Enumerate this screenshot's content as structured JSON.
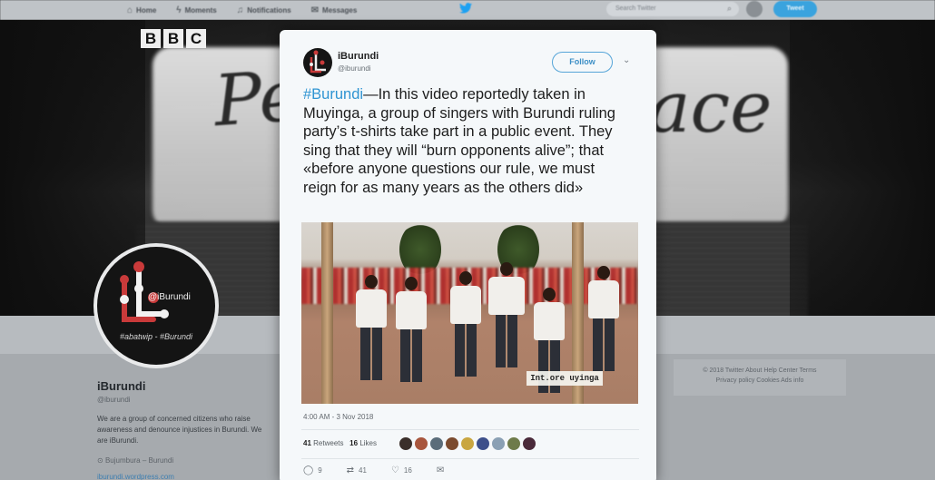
{
  "nav": {
    "items": [
      {
        "icon": "home-icon",
        "glyph": "⌂",
        "label": "Home"
      },
      {
        "icon": "moments-icon",
        "glyph": "ϟ",
        "label": "Moments"
      },
      {
        "icon": "bell-icon",
        "glyph": "♫",
        "label": "Notifications"
      },
      {
        "icon": "mail-icon",
        "glyph": "✉",
        "label": "Messages"
      }
    ],
    "search_placeholder": "Search Twitter",
    "tweet_button": "Tweet"
  },
  "overlay": {
    "broadcaster_letters": [
      "B",
      "B",
      "C"
    ]
  },
  "header": {
    "script_left": "Pe",
    "script_right": "ace"
  },
  "profile": {
    "avatar_handle": "@iBurundi",
    "avatar_tags": "#abatwip - #Burundi",
    "name": "iBurundi",
    "handle": "@iburundi",
    "bio": "We are a group of concerned citizens who raise awareness and denounce injustices in Burundi. We are iBurundi.",
    "location": "Bujumbura – Burundi",
    "link": "iburundi.wordpress.com"
  },
  "footer": {
    "line1": "© 2018 Twitter   About   Help Center   Terms",
    "line2": "Privacy policy   Cookies   Ads info"
  },
  "tweet": {
    "name": "iBurundi",
    "handle": "@iburundi",
    "follow_label": "Follow",
    "hashtag": "#Burundi",
    "body": "—In this video reportedly taken in Muyinga, a group of singers with Burundi ruling party’s t-shirts take part in a public event. They sing that  they will “burn opponents alive”; that «before anyone questions our rule, we must reign for as many years as the others did»",
    "video_caption": "Int.ore uyinga",
    "timestamp": "4:00 AM - 3 Nov 2018",
    "retweets_count": "41",
    "retweets_label": "Retweets",
    "likes_count": "16",
    "likes_label": "Likes",
    "liker_colors": [
      "#3a2f2a",
      "#a8563d",
      "#5b6d7a",
      "#7b4b2f",
      "#c9a640",
      "#3c4f8a",
      "#8aa0b4",
      "#6e7b4a",
      "#4a2a3a"
    ],
    "actions": [
      {
        "icon": "reply-icon",
        "glyph": "◯",
        "count": "9"
      },
      {
        "icon": "retweet-icon",
        "glyph": "⇄",
        "count": "41"
      },
      {
        "icon": "like-icon",
        "glyph": "♡",
        "count": "16"
      },
      {
        "icon": "dm-icon",
        "glyph": "✉",
        "count": ""
      }
    ]
  },
  "colors": {
    "accent": "#1da1f2",
    "hashtag": "#2f94d2",
    "follow_border": "#56a5d8"
  }
}
